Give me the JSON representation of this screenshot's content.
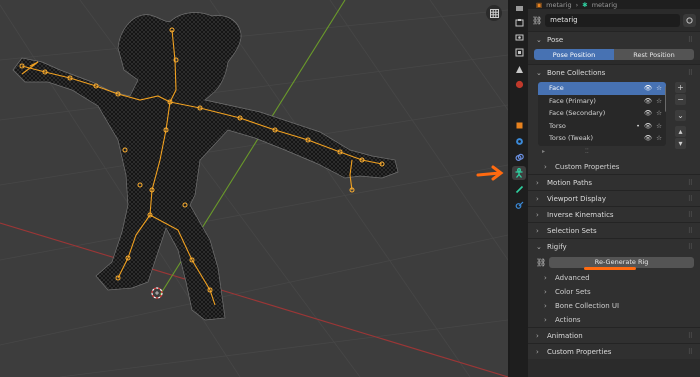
{
  "header": {
    "crumb_object": "metarig",
    "crumb_data": "metarig"
  },
  "object": {
    "name": "metarig",
    "icon": "armature-data-icon"
  },
  "panels": {
    "pose": {
      "title": "Pose",
      "pose_position": "Pose Position",
      "rest_position": "Rest Position",
      "active_mode": "Pose Position"
    },
    "bone_collections": {
      "title": "Bone Collections",
      "items": [
        {
          "label": "Face",
          "selected": true,
          "active": false
        },
        {
          "label": "Face (Primary)",
          "selected": false,
          "active": false
        },
        {
          "label": "Face (Secondary)",
          "selected": false,
          "active": false
        },
        {
          "label": "Torso",
          "selected": false,
          "active": true
        },
        {
          "label": "Torso (Tweak)",
          "selected": false,
          "active": false
        }
      ],
      "custom_properties": "Custom Properties"
    },
    "motion_paths": "Motion Paths",
    "viewport_display": "Viewport Display",
    "inverse_kinematics": "Inverse Kinematics",
    "selection_sets": "Selection Sets",
    "rigify": {
      "title": "Rigify",
      "regenerate": "Re-Generate Rig",
      "subpanels": [
        "Advanced",
        "Color Sets",
        "Bone Collection UI",
        "Actions"
      ]
    },
    "animation": "Animation",
    "custom_properties": "Custom Properties"
  },
  "colors": {
    "accent": "#4772b3",
    "annotation": "#ff6a10",
    "bone": "#f0a020",
    "active_tab": "#2fd0a0"
  }
}
